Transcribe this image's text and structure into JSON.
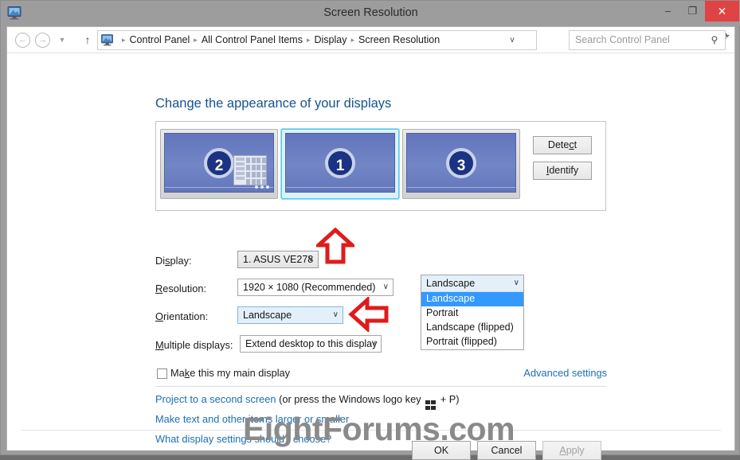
{
  "window": {
    "title": "Screen Resolution",
    "app_icon": "display-monitor-icon",
    "minimize_label": "–",
    "maximize_label": "❐",
    "close_label": "✕",
    "close_color": "#e04343"
  },
  "addressbar": {
    "back_label": "←",
    "forward_label": "→",
    "recent_label": "▼",
    "up_label": "↑",
    "breadcrumb_icon": "display-monitor-icon",
    "breadcrumbs": [
      "Control Panel",
      "All Control Panel Items",
      "Display",
      "Screen Resolution"
    ],
    "separator": "▸",
    "dropdown_caret": "∨",
    "refresh_label": "⟳",
    "search_placeholder": "Search Control Panel",
    "search_value": "",
    "search_icon": "search-icon"
  },
  "page": {
    "heading": "Change the appearance of your displays",
    "heading_color": "#16538e"
  },
  "preview": {
    "monitors": [
      {
        "number": "2",
        "selected": false,
        "has_tile_graphic": true
      },
      {
        "number": "1",
        "selected": true,
        "has_tile_graphic": false
      },
      {
        "number": "3",
        "selected": false,
        "has_tile_graphic": false
      }
    ],
    "detect_label": "Detect",
    "detect_accel": "Dete",
    "detect_accel_char": "c",
    "detect_tail": "t",
    "identify_accel_char": "I",
    "identify_tail": "dentify",
    "selection_color": "#5ec8e8"
  },
  "form": {
    "display": {
      "label_pre": "Di",
      "label_accel": "s",
      "label_post": "play:",
      "value": "1. ASUS VE278",
      "caret": "∨"
    },
    "resolution": {
      "label_accel": "R",
      "label_post": "esolution:",
      "value": "1920 × 1080 (Recommended)",
      "caret": "∨"
    },
    "orientation": {
      "label_accel": "O",
      "label_post": "rientation:",
      "value": "Landscape",
      "caret": "∨",
      "options": [
        "Landscape",
        "Portrait",
        "Landscape (flipped)",
        "Portrait (flipped)"
      ],
      "selected_option": "Landscape",
      "highlight_color": "#3399ff"
    },
    "multiple_displays": {
      "label_accel": "M",
      "label_post": "ultiple displays:",
      "value": "Extend desktop to this display",
      "caret": "∨"
    },
    "main_display": {
      "label_pre": "Ma",
      "label_accel": "k",
      "label_post": "e this my main display",
      "checked": false
    },
    "advanced_settings": "Advanced settings"
  },
  "links": {
    "project_pre": "Project to a second screen",
    "project_mid": " (or press the Windows logo key ",
    "project_post": " + P)",
    "windows_logo": "windows-logo-icon",
    "text_size": "Make text and other items larger or smaller",
    "what_settings": "What display settings should I choose?",
    "link_color": "#1a6fb5"
  },
  "watermark": {
    "text": "EightForums.com",
    "color": "#8a8a8a"
  },
  "buttons": {
    "ok": "OK",
    "cancel": "Cancel",
    "apply_accel": "A",
    "apply_post": "pply",
    "apply_enabled": false
  },
  "annotations": {
    "arrow_color": "#e01b1b",
    "up_arrow": "up-arrow-annotation",
    "left_arrow": "left-arrow-annotation"
  }
}
